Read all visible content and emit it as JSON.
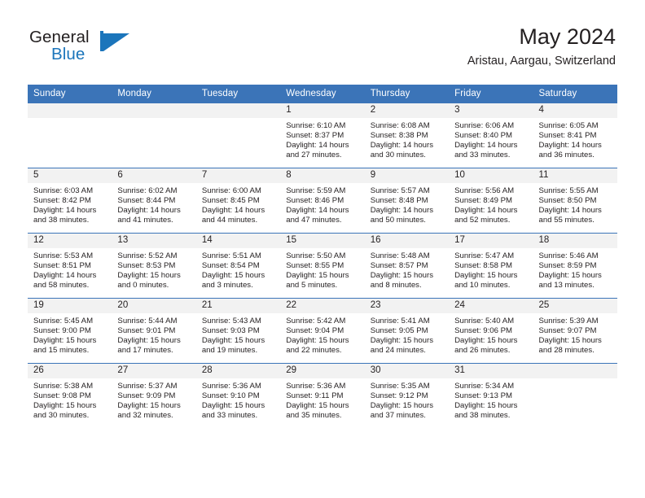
{
  "brand": {
    "name_part1": "General",
    "name_part2": "Blue",
    "mark_icon": "flag-triangle-icon"
  },
  "header": {
    "title": "May 2024",
    "subtitle": "Aristau, Aargau, Switzerland"
  },
  "calendar": {
    "weekday_headers": [
      "Sunday",
      "Monday",
      "Tuesday",
      "Wednesday",
      "Thursday",
      "Friday",
      "Saturday"
    ],
    "accent_color": "#3b74b8",
    "daynum_band_color": "#f2f2f2",
    "weeks": [
      [
        {
          "day": "",
          "lines": []
        },
        {
          "day": "",
          "lines": []
        },
        {
          "day": "",
          "lines": []
        },
        {
          "day": "1",
          "lines": [
            "Sunrise: 6:10 AM",
            "Sunset: 8:37 PM",
            "Daylight: 14 hours",
            "and 27 minutes."
          ]
        },
        {
          "day": "2",
          "lines": [
            "Sunrise: 6:08 AM",
            "Sunset: 8:38 PM",
            "Daylight: 14 hours",
            "and 30 minutes."
          ]
        },
        {
          "day": "3",
          "lines": [
            "Sunrise: 6:06 AM",
            "Sunset: 8:40 PM",
            "Daylight: 14 hours",
            "and 33 minutes."
          ]
        },
        {
          "day": "4",
          "lines": [
            "Sunrise: 6:05 AM",
            "Sunset: 8:41 PM",
            "Daylight: 14 hours",
            "and 36 minutes."
          ]
        }
      ],
      [
        {
          "day": "5",
          "lines": [
            "Sunrise: 6:03 AM",
            "Sunset: 8:42 PM",
            "Daylight: 14 hours",
            "and 38 minutes."
          ]
        },
        {
          "day": "6",
          "lines": [
            "Sunrise: 6:02 AM",
            "Sunset: 8:44 PM",
            "Daylight: 14 hours",
            "and 41 minutes."
          ]
        },
        {
          "day": "7",
          "lines": [
            "Sunrise: 6:00 AM",
            "Sunset: 8:45 PM",
            "Daylight: 14 hours",
            "and 44 minutes."
          ]
        },
        {
          "day": "8",
          "lines": [
            "Sunrise: 5:59 AM",
            "Sunset: 8:46 PM",
            "Daylight: 14 hours",
            "and 47 minutes."
          ]
        },
        {
          "day": "9",
          "lines": [
            "Sunrise: 5:57 AM",
            "Sunset: 8:48 PM",
            "Daylight: 14 hours",
            "and 50 minutes."
          ]
        },
        {
          "day": "10",
          "lines": [
            "Sunrise: 5:56 AM",
            "Sunset: 8:49 PM",
            "Daylight: 14 hours",
            "and 52 minutes."
          ]
        },
        {
          "day": "11",
          "lines": [
            "Sunrise: 5:55 AM",
            "Sunset: 8:50 PM",
            "Daylight: 14 hours",
            "and 55 minutes."
          ]
        }
      ],
      [
        {
          "day": "12",
          "lines": [
            "Sunrise: 5:53 AM",
            "Sunset: 8:51 PM",
            "Daylight: 14 hours",
            "and 58 minutes."
          ]
        },
        {
          "day": "13",
          "lines": [
            "Sunrise: 5:52 AM",
            "Sunset: 8:53 PM",
            "Daylight: 15 hours",
            "and 0 minutes."
          ]
        },
        {
          "day": "14",
          "lines": [
            "Sunrise: 5:51 AM",
            "Sunset: 8:54 PM",
            "Daylight: 15 hours",
            "and 3 minutes."
          ]
        },
        {
          "day": "15",
          "lines": [
            "Sunrise: 5:50 AM",
            "Sunset: 8:55 PM",
            "Daylight: 15 hours",
            "and 5 minutes."
          ]
        },
        {
          "day": "16",
          "lines": [
            "Sunrise: 5:48 AM",
            "Sunset: 8:57 PM",
            "Daylight: 15 hours",
            "and 8 minutes."
          ]
        },
        {
          "day": "17",
          "lines": [
            "Sunrise: 5:47 AM",
            "Sunset: 8:58 PM",
            "Daylight: 15 hours",
            "and 10 minutes."
          ]
        },
        {
          "day": "18",
          "lines": [
            "Sunrise: 5:46 AM",
            "Sunset: 8:59 PM",
            "Daylight: 15 hours",
            "and 13 minutes."
          ]
        }
      ],
      [
        {
          "day": "19",
          "lines": [
            "Sunrise: 5:45 AM",
            "Sunset: 9:00 PM",
            "Daylight: 15 hours",
            "and 15 minutes."
          ]
        },
        {
          "day": "20",
          "lines": [
            "Sunrise: 5:44 AM",
            "Sunset: 9:01 PM",
            "Daylight: 15 hours",
            "and 17 minutes."
          ]
        },
        {
          "day": "21",
          "lines": [
            "Sunrise: 5:43 AM",
            "Sunset: 9:03 PM",
            "Daylight: 15 hours",
            "and 19 minutes."
          ]
        },
        {
          "day": "22",
          "lines": [
            "Sunrise: 5:42 AM",
            "Sunset: 9:04 PM",
            "Daylight: 15 hours",
            "and 22 minutes."
          ]
        },
        {
          "day": "23",
          "lines": [
            "Sunrise: 5:41 AM",
            "Sunset: 9:05 PM",
            "Daylight: 15 hours",
            "and 24 minutes."
          ]
        },
        {
          "day": "24",
          "lines": [
            "Sunrise: 5:40 AM",
            "Sunset: 9:06 PM",
            "Daylight: 15 hours",
            "and 26 minutes."
          ]
        },
        {
          "day": "25",
          "lines": [
            "Sunrise: 5:39 AM",
            "Sunset: 9:07 PM",
            "Daylight: 15 hours",
            "and 28 minutes."
          ]
        }
      ],
      [
        {
          "day": "26",
          "lines": [
            "Sunrise: 5:38 AM",
            "Sunset: 9:08 PM",
            "Daylight: 15 hours",
            "and 30 minutes."
          ]
        },
        {
          "day": "27",
          "lines": [
            "Sunrise: 5:37 AM",
            "Sunset: 9:09 PM",
            "Daylight: 15 hours",
            "and 32 minutes."
          ]
        },
        {
          "day": "28",
          "lines": [
            "Sunrise: 5:36 AM",
            "Sunset: 9:10 PM",
            "Daylight: 15 hours",
            "and 33 minutes."
          ]
        },
        {
          "day": "29",
          "lines": [
            "Sunrise: 5:36 AM",
            "Sunset: 9:11 PM",
            "Daylight: 15 hours",
            "and 35 minutes."
          ]
        },
        {
          "day": "30",
          "lines": [
            "Sunrise: 5:35 AM",
            "Sunset: 9:12 PM",
            "Daylight: 15 hours",
            "and 37 minutes."
          ]
        },
        {
          "day": "31",
          "lines": [
            "Sunrise: 5:34 AM",
            "Sunset: 9:13 PM",
            "Daylight: 15 hours",
            "and 38 minutes."
          ]
        },
        {
          "day": "",
          "lines": []
        }
      ]
    ]
  }
}
